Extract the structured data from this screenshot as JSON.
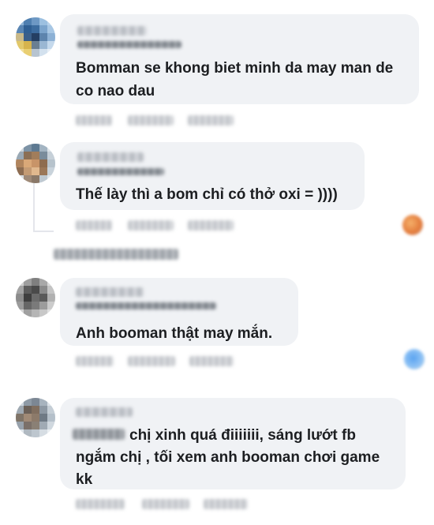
{
  "comments": [
    {
      "text": "Bomman se khong biet minh da may man de co nao dau",
      "line1": "Bomman se khong biet minh da may man de",
      "line2": "co nao dau"
    },
    {
      "text": "Thế lày thì a bom chỉ có thở oxi = ))))"
    },
    {
      "text": "Anh booman thật may mắn."
    },
    {
      "line1": "chị xinh quá điiiiiii, sáng lướt fb",
      "line2": "ngắm chị , tối xem anh booman chơi game",
      "line3": "kk"
    }
  ],
  "colors": {
    "bubble": "#f0f2f5",
    "text": "#1c1e21"
  },
  "icons": [
    "avatar",
    "reaction-icon"
  ]
}
